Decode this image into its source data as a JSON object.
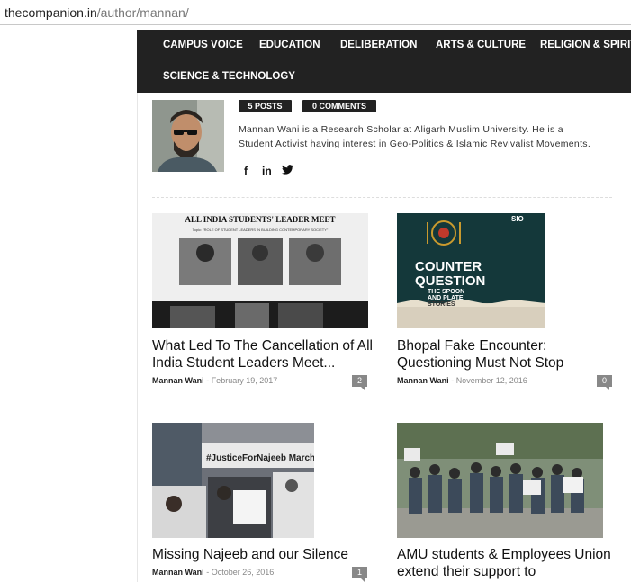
{
  "browser": {
    "url_domain": "thecompanion.in",
    "url_path": "/author/mannan/"
  },
  "nav": {
    "items": [
      "CAMPUS VOICE",
      "EDUCATION",
      "DELIBERATION",
      "ARTS & CULTURE",
      "RELIGION & SPIRIT",
      "SCIENCE & TECHNOLOGY"
    ]
  },
  "author": {
    "posts_badge": "5 POSTS",
    "comments_badge": "0 COMMENTS",
    "bio": "Mannan Wani is a Research Scholar at Aligarh Muslim University. He is a Student Activist having interest in Geo-Politics & Islamic Revivalist Movements.",
    "social": [
      "f",
      "in",
      "🐦"
    ]
  },
  "articles": [
    {
      "title": "What Led To The Cancellation of All India Student Leaders Meet...",
      "author": "Mannan Wani",
      "date": "February 19, 2017",
      "comments": "2",
      "image_heading": "ALL INDIA STUDENTS' LEADER MEET",
      "image_subheading": "Topic: \"ROLE OF STUDENT LEADERS IN BUILDING CONTEMPORARY SOCIETY\""
    },
    {
      "title": "Bhopal Fake Encounter: Questioning Must Not Stop",
      "author": "Mannan Wani",
      "date": "November 12, 2016",
      "comments": "0",
      "image_line1": "COUNTER",
      "image_line2": "QUESTION",
      "image_line3": "THE SPOON",
      "image_line4": "AND PLATE",
      "image_line5": "STORIES",
      "image_tag": "SIO"
    },
    {
      "title": "Missing Najeeb and our Silence",
      "author": "Mannan Wani",
      "date": "October 26, 2016",
      "comments": "1",
      "image_banner": "#JusticeForNajeeb March"
    },
    {
      "title": "AMU students & Employees Union extend their support to",
      "author": "",
      "date": "",
      "comments": ""
    }
  ],
  "colors": {
    "nav_bg": "#222222",
    "badge_bg": "#222222",
    "comment_bg": "#888888"
  }
}
